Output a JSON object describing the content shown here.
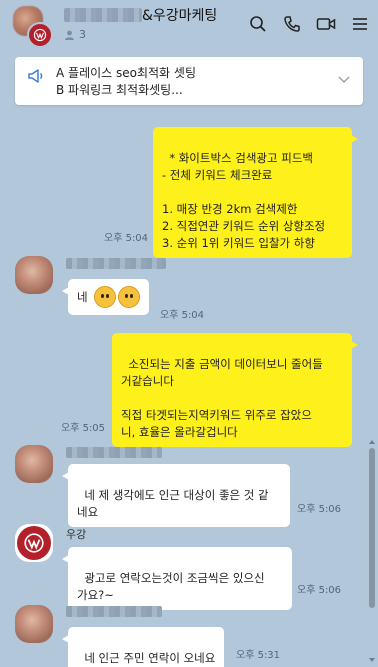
{
  "header": {
    "title_suffix": "&우강마케팅",
    "member_count": "3"
  },
  "icons": {
    "search": "search-icon",
    "call": "phone-icon",
    "video": "video-icon",
    "menu": "menu-icon"
  },
  "notice": {
    "line1": "A 플레이스 seo최적화 셋팅",
    "line2": "B 파워링크 최적화셋팅..."
  },
  "messages": [
    {
      "from": "me",
      "text": "* 화이트박스 검색광고 피드백\n- 전체 키워드 체크완료\n\n1. 매장 반경 2km 검색제한\n2. 직접연관 키워드 순위 상향조정\n3. 순위 1위 키워드 입찰가 하향",
      "time": "오후 5:04"
    },
    {
      "from": "other",
      "text": "네",
      "time": "오후 5:04"
    },
    {
      "from": "me",
      "text": "소진되는 지출 금액이 데이터보니 줄어들\n거같습니다\n\n직접 타겟되는지역키워드 위주로 잡았으\n니, 효율은 올라갈겁니다",
      "time": "오후 5:05"
    },
    {
      "from": "other",
      "text": "네 제 생각에도 인근 대상이 좋은 것 같\n네요",
      "time": "오후 5:06"
    },
    {
      "from": "other",
      "sender": "우강",
      "text": "광고로 연락오는것이 조금씩은 있으신\n가요?~",
      "time": "오후 5:06"
    },
    {
      "from": "other",
      "text": "네 인근 주민 연락이 오네요",
      "time": "오후 5:31"
    }
  ],
  "colors": {
    "background": "#b2c7d9",
    "my_bubble": "#fef01b",
    "other_bubble": "#ffffff",
    "brand": "#b3202a"
  }
}
